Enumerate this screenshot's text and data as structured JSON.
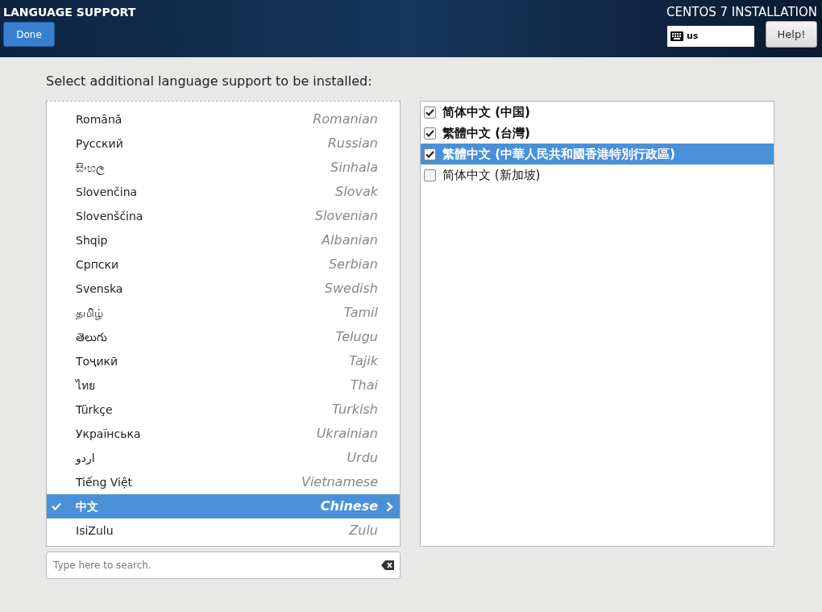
{
  "header": {
    "title": "LANGUAGE SUPPORT",
    "done_button": "Done",
    "product": "CENTOS 7 INSTALLATION",
    "keyboard_layout": "us",
    "help_button": "Help!"
  },
  "prompt": "Select additional language support to be installed:",
  "languages": [
    {
      "native": "Română",
      "english": "Romanian",
      "selected": false,
      "checked": false
    },
    {
      "native": "Русский",
      "english": "Russian",
      "selected": false,
      "checked": false
    },
    {
      "native": "සිංහල",
      "english": "Sinhala",
      "selected": false,
      "checked": false
    },
    {
      "native": "Slovenčina",
      "english": "Slovak",
      "selected": false,
      "checked": false
    },
    {
      "native": "Slovenščina",
      "english": "Slovenian",
      "selected": false,
      "checked": false
    },
    {
      "native": "Shqip",
      "english": "Albanian",
      "selected": false,
      "checked": false
    },
    {
      "native": "Српски",
      "english": "Serbian",
      "selected": false,
      "checked": false
    },
    {
      "native": "Svenska",
      "english": "Swedish",
      "selected": false,
      "checked": false
    },
    {
      "native": "தமிழ்",
      "english": "Tamil",
      "selected": false,
      "checked": false
    },
    {
      "native": "తెలుగు",
      "english": "Telugu",
      "selected": false,
      "checked": false
    },
    {
      "native": "Тоҷикӣ",
      "english": "Tajik",
      "selected": false,
      "checked": false
    },
    {
      "native": "ไทย",
      "english": "Thai",
      "selected": false,
      "checked": false
    },
    {
      "native": "Türkçe",
      "english": "Turkish",
      "selected": false,
      "checked": false
    },
    {
      "native": "Українська",
      "english": "Ukrainian",
      "selected": false,
      "checked": false
    },
    {
      "native": "اردو",
      "english": "Urdu",
      "selected": false,
      "checked": false
    },
    {
      "native": "Tiếng Việt",
      "english": "Vietnamese",
      "selected": false,
      "checked": false
    },
    {
      "native": "中文",
      "english": "Chinese",
      "selected": true,
      "checked": true
    },
    {
      "native": "IsiZulu",
      "english": "Zulu",
      "selected": false,
      "checked": false
    }
  ],
  "search": {
    "placeholder": "Type here to search."
  },
  "locales": [
    {
      "label": "简体中文 (中国)",
      "checked": true,
      "selected": false
    },
    {
      "label": "繁體中文 (台灣)",
      "checked": true,
      "selected": false
    },
    {
      "label": "繁體中文 (中華人民共和國香港特別行政區)",
      "checked": true,
      "selected": true
    },
    {
      "label": "简体中文 (新加坡)",
      "checked": false,
      "selected": false
    }
  ]
}
